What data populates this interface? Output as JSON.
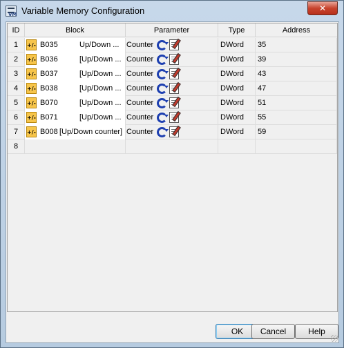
{
  "window": {
    "title": "Variable Memory Configuration",
    "close_label": "✕"
  },
  "table": {
    "columns": {
      "id": "ID",
      "block": "Block",
      "parameter": "Parameter",
      "type": "Type",
      "address": "Address"
    },
    "rows": [
      {
        "id": "1",
        "block_id": "B035",
        "block_name": "Up/Down ...",
        "parameter": "Counter",
        "type": "DWord",
        "address": "35"
      },
      {
        "id": "2",
        "block_id": "B036",
        "block_name": "[Up/Down ...",
        "parameter": "Counter",
        "type": "DWord",
        "address": "39"
      },
      {
        "id": "3",
        "block_id": "B037",
        "block_name": "[Up/Down ...",
        "parameter": "Counter",
        "type": "DWord",
        "address": "43"
      },
      {
        "id": "4",
        "block_id": "B038",
        "block_name": "[Up/Down ...",
        "parameter": "Counter",
        "type": "DWord",
        "address": "47"
      },
      {
        "id": "5",
        "block_id": "B070",
        "block_name": "[Up/Down ...",
        "parameter": "Counter",
        "type": "DWord",
        "address": "51"
      },
      {
        "id": "6",
        "block_id": "B071",
        "block_name": "[Up/Down ...",
        "parameter": "Counter",
        "type": "DWord",
        "address": "55"
      },
      {
        "id": "7",
        "block_id": "B008",
        "block_name": "[Up/Down counter]",
        "parameter": "Counter",
        "type": "DWord",
        "address": "59"
      },
      {
        "id": "8",
        "block_id": "",
        "block_name": "",
        "parameter": "",
        "type": "",
        "address": ""
      }
    ]
  },
  "icons": {
    "block": "updown-counter-block-icon",
    "counter": "counter-icon",
    "edit": "edit-icon"
  },
  "block_icon_glyph": "+/-",
  "buttons": {
    "ok": "OK",
    "cancel": "Cancel",
    "help": "Help"
  }
}
